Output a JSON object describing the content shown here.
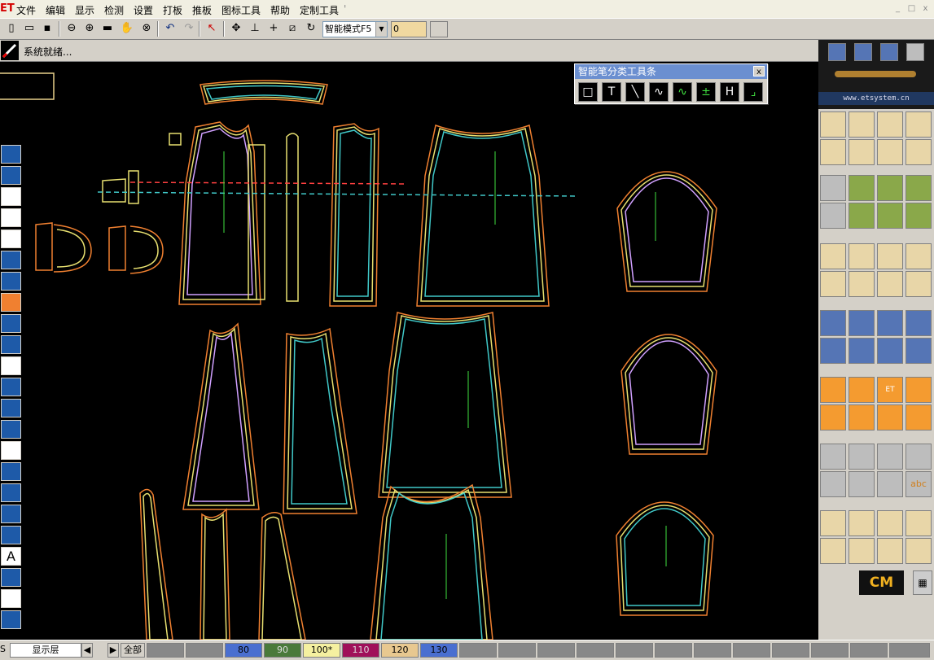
{
  "app": {
    "logo": "ET"
  },
  "menu": {
    "items": [
      "文件",
      "编辑",
      "显示",
      "检测",
      "设置",
      "打板",
      "推板",
      "图标工具",
      "帮助",
      "定制工具"
    ],
    "tail": "'"
  },
  "window_buttons": [
    "_",
    "□",
    "x"
  ],
  "toolbar": {
    "mode_select": "智能模式F5",
    "value_input": "0"
  },
  "status": {
    "text": "系统就绪..."
  },
  "floating_toolbar": {
    "title": "智能笔分类工具条",
    "close": "x"
  },
  "right_panel": {
    "url": "www.etsystem.cn",
    "brand": "CM"
  },
  "bottom": {
    "prefix": "S",
    "layer_select": "显示层",
    "all_button": "全部",
    "sizes": [
      {
        "label": "80",
        "color": "#4a6fd0"
      },
      {
        "label": "90",
        "color": "#4a7a3a"
      },
      {
        "label": "100*",
        "color": "#f5f0a0"
      },
      {
        "label": "110",
        "color": "#a0105a"
      },
      {
        "label": "120",
        "color": "#e8c890"
      },
      {
        "label": "130",
        "color": "#4a6fd0"
      }
    ]
  }
}
